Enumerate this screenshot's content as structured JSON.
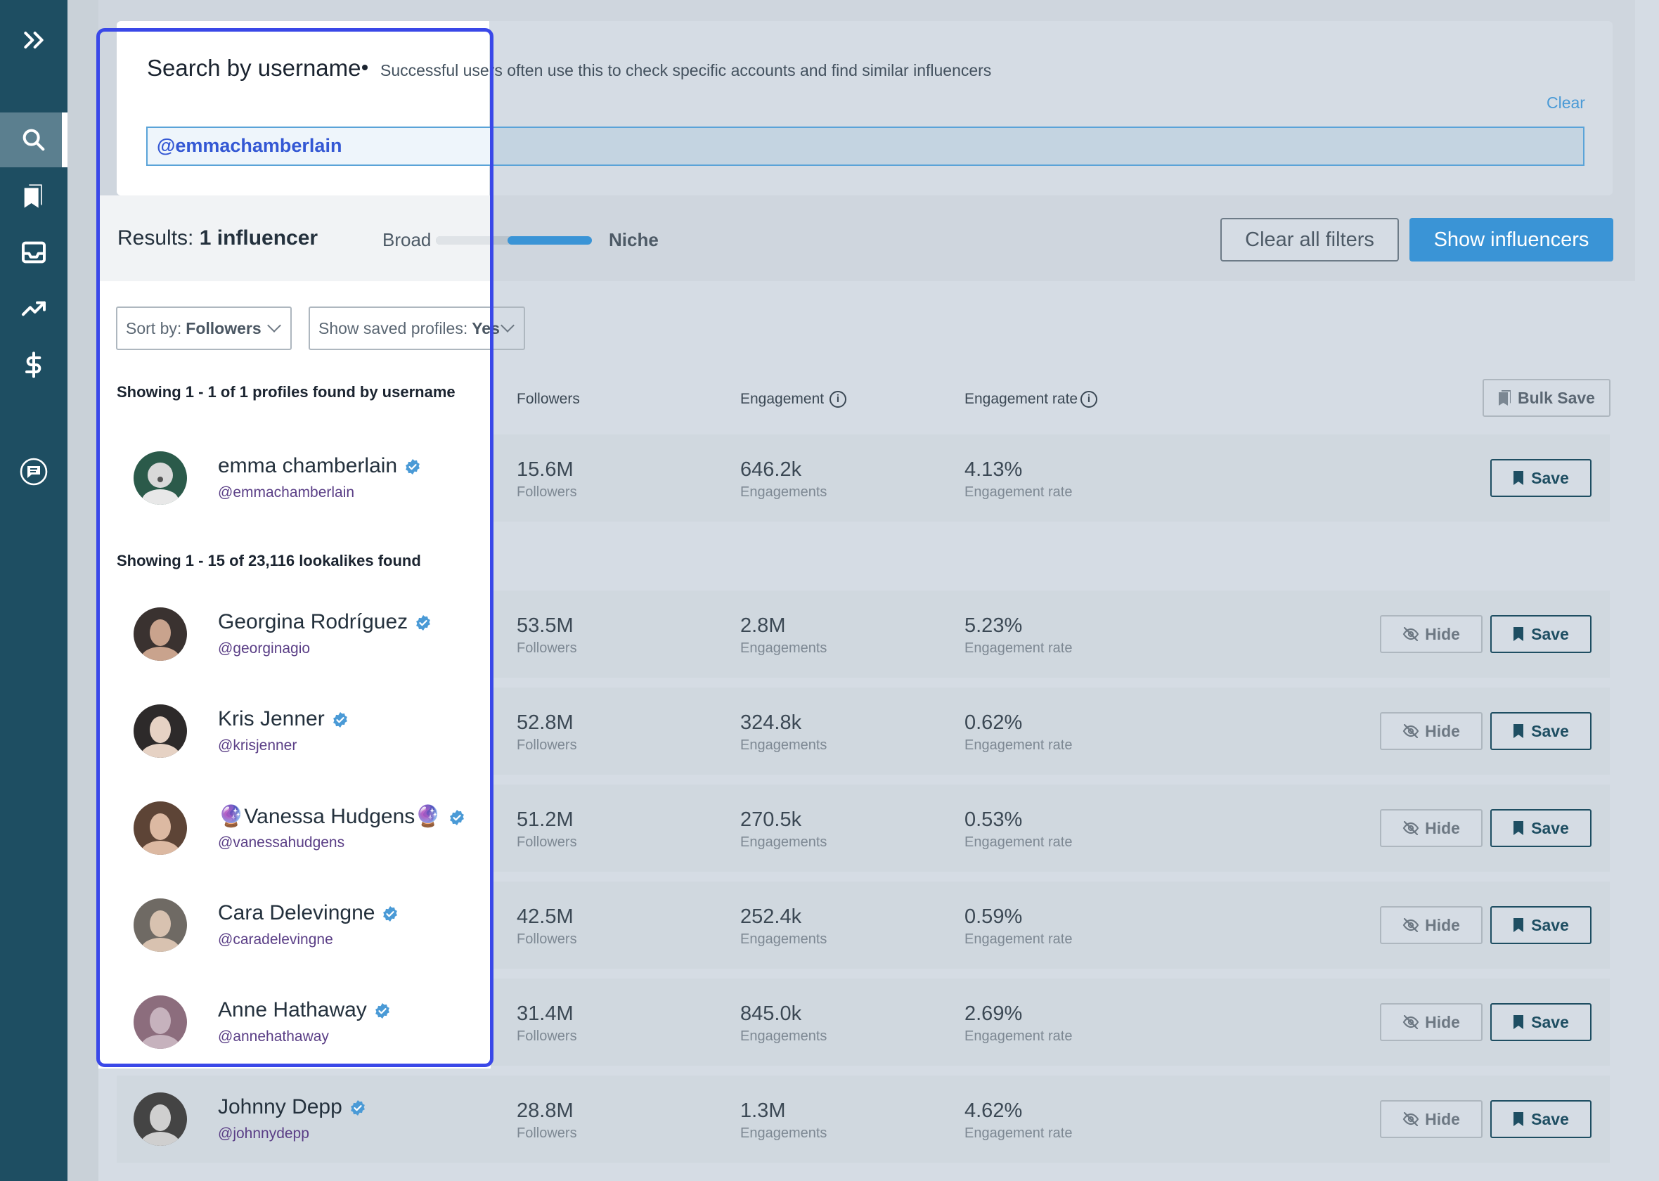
{
  "sidebar": {
    "items": [
      {
        "icon": "expand-icon"
      },
      {
        "icon": "search-icon",
        "active": true
      },
      {
        "icon": "bookmark-icon"
      },
      {
        "icon": "inbox-icon"
      },
      {
        "icon": "trending-icon"
      },
      {
        "icon": "dollar-icon"
      },
      {
        "icon": "chat-icon"
      }
    ]
  },
  "search": {
    "title": "Search by username",
    "subtitle": "Successful users often use this to check specific accounts and find similar influencers",
    "clear_label": "Clear",
    "value": "@emmachamberlain"
  },
  "results": {
    "prefix": "Results:",
    "count": "1 influencer",
    "broad_label": "Broad",
    "niche_label": "Niche",
    "niche_level": 0.5,
    "clear_filters_label": "Clear all filters",
    "show_influencers_label": "Show influencers"
  },
  "controls": {
    "sort_prefix": "Sort by:",
    "sort_value": "Followers",
    "saved_prefix": "Show saved profiles:",
    "saved_value": "Yes",
    "bulk_save_label": "Bulk Save"
  },
  "columns": {
    "followers": "Followers",
    "engagement": "Engagement",
    "engagement_rate": "Engagement rate"
  },
  "username_section": {
    "heading": "Showing 1 - 1 of 1 profiles found by username",
    "rows": [
      {
        "name": "emma chamberlain",
        "handle": "@emmachamberlain",
        "followers": "15.6M",
        "followers_label": "Followers",
        "engagement": "646.2k",
        "engagement_label": "Engagements",
        "rate": "4.13%",
        "rate_label": "Engagement rate",
        "save_label": "Save"
      }
    ]
  },
  "lookalike_section": {
    "heading": "Showing 1 - 15 of 23,116 lookalikes found",
    "hide_label": "Hide",
    "save_label": "Save",
    "rows": [
      {
        "name": "Georgina Rodríguez",
        "handle": "@georginagio",
        "followers": "53.5M",
        "followers_label": "Followers",
        "engagement": "2.8M",
        "engagement_label": "Engagements",
        "rate": "5.23%",
        "rate_label": "Engagement rate"
      },
      {
        "name": "Kris Jenner",
        "handle": "@krisjenner",
        "followers": "52.8M",
        "followers_label": "Followers",
        "engagement": "324.8k",
        "engagement_label": "Engagements",
        "rate": "0.62%",
        "rate_label": "Engagement rate"
      },
      {
        "name": "🔮Vanessa Hudgens🔮",
        "handle": "@vanessahudgens",
        "followers": "51.2M",
        "followers_label": "Followers",
        "engagement": "270.5k",
        "engagement_label": "Engagements",
        "rate": "0.53%",
        "rate_label": "Engagement rate"
      },
      {
        "name": "Cara Delevingne",
        "handle": "@caradelevingne",
        "followers": "42.5M",
        "followers_label": "Followers",
        "engagement": "252.4k",
        "engagement_label": "Engagements",
        "rate": "0.59%",
        "rate_label": "Engagement rate"
      },
      {
        "name": "Anne Hathaway",
        "handle": "@annehathaway",
        "followers": "31.4M",
        "followers_label": "Followers",
        "engagement": "845.0k",
        "engagement_label": "Engagements",
        "rate": "2.69%",
        "rate_label": "Engagement rate"
      },
      {
        "name": "Johnny Depp",
        "handle": "@johnnydepp",
        "followers": "28.8M",
        "followers_label": "Followers",
        "engagement": "1.3M",
        "engagement_label": "Engagements",
        "rate": "4.62%",
        "rate_label": "Engagement rate"
      }
    ]
  },
  "colors": {
    "sidebar": "#1e4e62",
    "accent": "#3a94d6",
    "highlight": "#3a48e8",
    "verified": "#4a9ad6"
  }
}
